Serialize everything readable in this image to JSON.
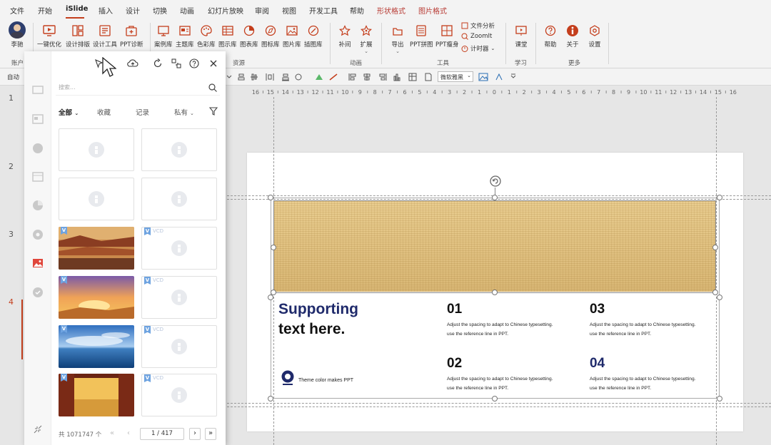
{
  "tabs": [
    "文件",
    "开始",
    "iSlide",
    "插入",
    "设计",
    "切换",
    "动画",
    "幻灯片放映",
    "审阅",
    "视图",
    "开发工具",
    "帮助",
    "形状格式",
    "图片格式"
  ],
  "ribbon": {
    "account_name": "李驰",
    "account_group": "账户",
    "buttons": {
      "one_click": "一键优化",
      "design_layout": "设计排版",
      "design_tools": "设计工具",
      "ppt_diag": "PPT诊断",
      "case_lib": "案例库",
      "theme_lib": "主题库",
      "color_lib": "色彩库",
      "chart_lib": "图示库",
      "graph_lib": "图表库",
      "icon_lib": "图标库",
      "image_lib": "图片库",
      "illus_lib": "插图库",
      "tween": "补间",
      "extend": "扩展",
      "export": "导出",
      "ppt_stitch": "PPT拼图",
      "ppt_slim": "PPT瘦身",
      "file_analysis": "文件分析",
      "zoomit": "ZoomIt",
      "timer": "计时器",
      "classroom": "课堂",
      "help": "帮助",
      "about": "关于",
      "settings": "设置"
    },
    "groups": {
      "resources": "资源",
      "animation": "动画",
      "tools": "工具",
      "learning": "学习",
      "more": "更多"
    }
  },
  "toolbar": {
    "auto_label": "自动",
    "font_name": "微软雅黑"
  },
  "ruler_labels": [
    "16",
    "15",
    "14",
    "13",
    "12",
    "11",
    "10",
    "9",
    "8",
    "7",
    "6",
    "5",
    "4",
    "3",
    "2",
    "1",
    "0",
    "1",
    "2",
    "3",
    "4",
    "5",
    "6",
    "7",
    "8",
    "9",
    "10",
    "11",
    "12",
    "13",
    "14",
    "15",
    "16"
  ],
  "slide_numbers": [
    "1",
    "2",
    "3",
    "4"
  ],
  "panel": {
    "search_placeholder": "搜索...",
    "filters": [
      "全部",
      "收藏",
      "记录",
      "私有"
    ],
    "vip_badge": "V",
    "vcd_text": "VCD",
    "total_label": "共 1071747 个",
    "page_indicator": "1 / 417"
  },
  "slide": {
    "headline_1": "Supporting",
    "headline_2": "text here.",
    "tagline": "Theme color makes PPT",
    "items": [
      {
        "num": "01",
        "line1": "Adjust the spacing to adapt to Chinese typesetting.",
        "line2": "use the reference line in PPT."
      },
      {
        "num": "02",
        "line1": "Adjust the spacing to adapt to Chinese typesetting.",
        "line2": "use the reference line in PPT."
      },
      {
        "num": "03",
        "line1": "Adjust the spacing to adapt to Chinese typesetting.",
        "line2": "use the reference line in PPT."
      },
      {
        "num": "04",
        "line1": "Adjust the spacing to adapt to Chinese typesetting.",
        "line2": "use the reference line in PPT."
      }
    ]
  },
  "colors": {
    "accent": "#c43e1c",
    "context_tab": "#b83b34",
    "headline_blue": "#1f2a6b",
    "banner": "#e7c98a",
    "vip_badge": "#6ea3e0"
  }
}
